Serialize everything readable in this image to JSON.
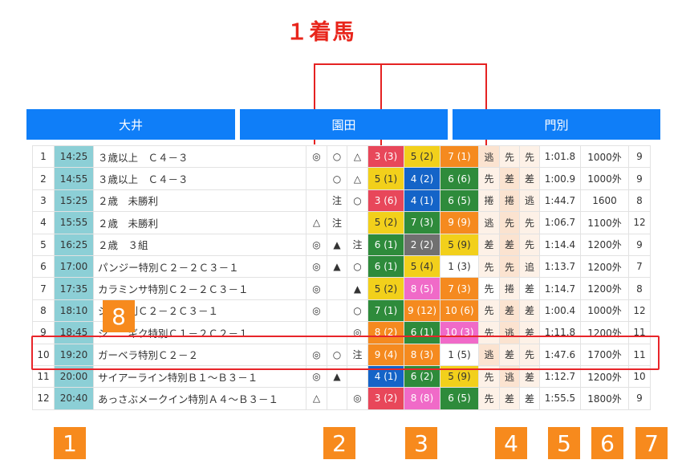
{
  "annotation": {
    "title": "１着馬"
  },
  "tabs": [
    {
      "label": "大井"
    },
    {
      "label": "園田"
    },
    {
      "label": "門別"
    }
  ],
  "colors": {
    "yellow": "#f2d01b",
    "blue": "#1464c8",
    "green": "#2e8b3b",
    "red": "#e8475a",
    "orange": "#f58a1f",
    "pink": "#f06ac8",
    "gray": "#707070",
    "white": "#ffffff",
    "run_light": "#fbe3d0",
    "run_lighter": "#fdf1e7"
  },
  "rows": [
    {
      "no": "1",
      "time": "14:25",
      "name": "３歳以上　Ｃ４－３",
      "m1": "◎",
      "m2": "○",
      "m3": "△",
      "r1": {
        "t": "3 (3)",
        "c": "red"
      },
      "r2": {
        "t": "5 (2)",
        "c": "yellow"
      },
      "r3": {
        "t": "7 (1)",
        "c": "orange"
      },
      "s1": {
        "t": "逃",
        "b": "run_light"
      },
      "s2": {
        "t": "先",
        "b": "run_lighter"
      },
      "s3": {
        "t": "先",
        "b": "run_lighter"
      },
      "time2": "1:01.8",
      "dist": "1000外",
      "heads": "9"
    },
    {
      "no": "2",
      "time": "14:55",
      "name": "３歳以上　Ｃ４－３",
      "m1": "",
      "m2": "○",
      "m3": "△",
      "r1": {
        "t": "5 (1)",
        "c": "yellow"
      },
      "r2": {
        "t": "4 (2)",
        "c": "blue"
      },
      "r3": {
        "t": "6 (6)",
        "c": "green"
      },
      "s1": {
        "t": "先",
        "b": "run_lighter"
      },
      "s2": {
        "t": "差",
        "b": "run_light"
      },
      "s3": {
        "t": "差",
        "b": "run_lighter"
      },
      "time2": "1:00.9",
      "dist": "1000外",
      "heads": "9"
    },
    {
      "no": "3",
      "time": "15:25",
      "name": "２歳　未勝利",
      "m1": "",
      "m2": "注",
      "m3": "○",
      "r1": {
        "t": "3 (6)",
        "c": "red"
      },
      "r2": {
        "t": "4 (1)",
        "c": "blue"
      },
      "r3": {
        "t": "6 (5)",
        "c": "green"
      },
      "s1": {
        "t": "捲",
        "b": "run_lighter"
      },
      "s2": {
        "t": "捲",
        "b": "run_light"
      },
      "s3": {
        "t": "逃",
        "b": "run_lighter"
      },
      "time2": "1:44.7",
      "dist": "1600",
      "heads": "8"
    },
    {
      "no": "4",
      "time": "15:55",
      "name": "２歳　未勝利",
      "m1": "△",
      "m2": "注",
      "m3": "",
      "r1": {
        "t": "5 (2)",
        "c": "yellow"
      },
      "r2": {
        "t": "7 (3)",
        "c": "green"
      },
      "r3": {
        "t": "9 (9)",
        "c": "orange"
      },
      "s1": {
        "t": "逃",
        "b": "run_lighter"
      },
      "s2": {
        "t": "先",
        "b": "run_light"
      },
      "s3": {
        "t": "先",
        "b": "run_lighter"
      },
      "time2": "1:06.7",
      "dist": "1100外",
      "heads": "12"
    },
    {
      "no": "5",
      "time": "16:25",
      "name": "２歳　３組",
      "m1": "◎",
      "m2": "▲",
      "m3": "注",
      "r1": {
        "t": "6 (1)",
        "c": "green"
      },
      "r2": {
        "t": "2 (2)",
        "c": "gray"
      },
      "r3": {
        "t": "5 (9)",
        "c": "yellow"
      },
      "s1": {
        "t": "差",
        "b": "run_lighter"
      },
      "s2": {
        "t": "差",
        "b": "run_light"
      },
      "s3": {
        "t": "先",
        "b": "run_lighter"
      },
      "time2": "1:14.4",
      "dist": "1200外",
      "heads": "9"
    },
    {
      "no": "6",
      "time": "17:00",
      "name": "パンジー特別Ｃ２－２Ｃ３－１",
      "m1": "◎",
      "m2": "▲",
      "m3": "○",
      "r1": {
        "t": "6 (1)",
        "c": "green"
      },
      "r2": {
        "t": "5 (4)",
        "c": "yellow"
      },
      "r3": {
        "t": "1 (3)",
        "c": "white"
      },
      "s1": {
        "t": "先",
        "b": "run_lighter"
      },
      "s2": {
        "t": "先",
        "b": "run_light"
      },
      "s3": {
        "t": "追",
        "b": "run_lighter"
      },
      "time2": "1:13.7",
      "dist": "1200外",
      "heads": "7"
    },
    {
      "no": "7",
      "time": "17:35",
      "name": "カラミンサ特別Ｃ２－２Ｃ３－１",
      "m1": "◎",
      "m2": "",
      "m3": "▲",
      "r1": {
        "t": "5 (2)",
        "c": "yellow"
      },
      "r2": {
        "t": "8 (5)",
        "c": "pink"
      },
      "r3": {
        "t": "7 (3)",
        "c": "orange"
      },
      "s1": {
        "t": "先",
        "b": "white"
      },
      "s2": {
        "t": "捲",
        "b": "run_lighter"
      },
      "s3": {
        "t": "差",
        "b": "white"
      },
      "time2": "1:14.7",
      "dist": "1200外",
      "heads": "8"
    },
    {
      "no": "8",
      "time": "18:10",
      "name": "ジ　　別Ｃ２－２Ｃ３－１",
      "m1": "◎",
      "m2": "",
      "m3": "○",
      "r1": {
        "t": "7 (1)",
        "c": "green"
      },
      "r2": {
        "t": "9 (12)",
        "c": "orange"
      },
      "r3": {
        "t": "10 (6)",
        "c": "orange"
      },
      "s1": {
        "t": "先",
        "b": "run_lighter"
      },
      "s2": {
        "t": "差",
        "b": "run_light"
      },
      "s3": {
        "t": "差",
        "b": "run_lighter"
      },
      "time2": "1:00.4",
      "dist": "1000外",
      "heads": "12"
    },
    {
      "no": "9",
      "time": "18:45",
      "name": "シ　　ギク特別Ｃ１－２Ｃ２－１",
      "m1": "",
      "m2": "",
      "m3": "◎",
      "r1": {
        "t": "8 (2)",
        "c": "orange"
      },
      "r2": {
        "t": "6 (1)",
        "c": "green"
      },
      "r3": {
        "t": "10 (3)",
        "c": "pink"
      },
      "s1": {
        "t": "先",
        "b": "run_lighter"
      },
      "s2": {
        "t": "逃",
        "b": "run_light"
      },
      "s3": {
        "t": "差",
        "b": "run_lighter"
      },
      "time2": "1:11.8",
      "dist": "1200外",
      "heads": "11"
    },
    {
      "no": "10",
      "time": "19:20",
      "name": "ガーベラ特別Ｃ２－２",
      "m1": "◎",
      "m2": "○",
      "m3": "注",
      "r1": {
        "t": "9 (4)",
        "c": "orange"
      },
      "r2": {
        "t": "8 (3)",
        "c": "orange"
      },
      "r3": {
        "t": "1 (5)",
        "c": "white"
      },
      "s1": {
        "t": "逃",
        "b": "run_light"
      },
      "s2": {
        "t": "差",
        "b": "run_lighter"
      },
      "s3": {
        "t": "先",
        "b": "run_lighter"
      },
      "time2": "1:47.6",
      "dist": "1700外",
      "heads": "11"
    },
    {
      "no": "11",
      "time": "20:00",
      "name": "サイアーライン特別Ｂ１～Ｂ３－１",
      "m1": "◎",
      "m2": "▲",
      "m3": "",
      "r1": {
        "t": "4 (1)",
        "c": "blue"
      },
      "r2": {
        "t": "6 (2)",
        "c": "green"
      },
      "r3": {
        "t": "5 (9)",
        "c": "yellow"
      },
      "s1": {
        "t": "先",
        "b": "run_lighter"
      },
      "s2": {
        "t": "逃",
        "b": "run_light"
      },
      "s3": {
        "t": "差",
        "b": "run_lighter"
      },
      "time2": "1:12.7",
      "dist": "1200外",
      "heads": "10"
    },
    {
      "no": "12",
      "time": "20:40",
      "name": "あっさぶメークイン特別Ａ４～Ｂ３－１",
      "m1": "△",
      "m2": "",
      "m3": "◎",
      "r1": {
        "t": "3 (2)",
        "c": "red"
      },
      "r2": {
        "t": "8 (8)",
        "c": "pink"
      },
      "r3": {
        "t": "6 (5)",
        "c": "green"
      },
      "s1": {
        "t": "先",
        "b": "run_lighter"
      },
      "s2": {
        "t": "差",
        "b": "run_lighter"
      },
      "s3": {
        "t": "差",
        "b": "white"
      },
      "time2": "1:55.5",
      "dist": "1800外",
      "heads": "9"
    }
  ],
  "badges": [
    "1",
    "2",
    "3",
    "4",
    "5",
    "6",
    "7",
    "8"
  ]
}
